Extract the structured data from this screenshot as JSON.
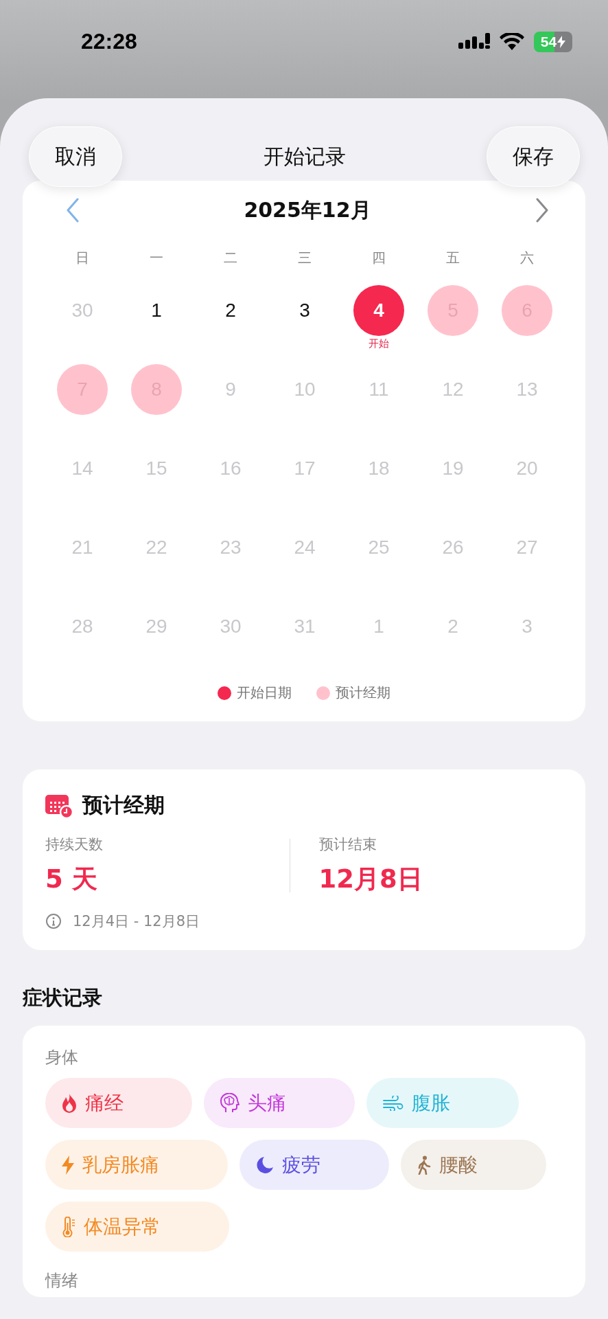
{
  "status_bar": {
    "time": "22:28",
    "battery": "54"
  },
  "header": {
    "cancel": "取消",
    "title": "开始记录",
    "save": "保存"
  },
  "calendar": {
    "month": "2025年12月",
    "weekdays": [
      "日",
      "一",
      "二",
      "三",
      "四",
      "五",
      "六"
    ],
    "days": [
      {
        "day": "30",
        "kind": "dim"
      },
      {
        "day": "1",
        "kind": "plain"
      },
      {
        "day": "2",
        "kind": "plain"
      },
      {
        "day": "3",
        "kind": "plain"
      },
      {
        "day": "4",
        "kind": "start",
        "label": "开始"
      },
      {
        "day": "5",
        "kind": "predicted"
      },
      {
        "day": "6",
        "kind": "predicted"
      },
      {
        "day": "7",
        "kind": "predicted"
      },
      {
        "day": "8",
        "kind": "predicted"
      },
      {
        "day": "9",
        "kind": "dim"
      },
      {
        "day": "10",
        "kind": "dim"
      },
      {
        "day": "11",
        "kind": "dim"
      },
      {
        "day": "12",
        "kind": "dim"
      },
      {
        "day": "13",
        "kind": "dim"
      },
      {
        "day": "14",
        "kind": "dim"
      },
      {
        "day": "15",
        "kind": "dim"
      },
      {
        "day": "16",
        "kind": "dim"
      },
      {
        "day": "17",
        "kind": "dim"
      },
      {
        "day": "18",
        "kind": "dim"
      },
      {
        "day": "19",
        "kind": "dim"
      },
      {
        "day": "20",
        "kind": "dim"
      },
      {
        "day": "21",
        "kind": "dim"
      },
      {
        "day": "22",
        "kind": "dim"
      },
      {
        "day": "23",
        "kind": "dim"
      },
      {
        "day": "24",
        "kind": "dim"
      },
      {
        "day": "25",
        "kind": "dim"
      },
      {
        "day": "26",
        "kind": "dim"
      },
      {
        "day": "27",
        "kind": "dim"
      },
      {
        "day": "28",
        "kind": "dim"
      },
      {
        "day": "29",
        "kind": "dim"
      },
      {
        "day": "30",
        "kind": "dim"
      },
      {
        "day": "31",
        "kind": "dim"
      },
      {
        "day": "1",
        "kind": "dim"
      },
      {
        "day": "2",
        "kind": "dim"
      },
      {
        "day": "3",
        "kind": "dim"
      }
    ],
    "legend": [
      {
        "label": "开始日期",
        "color": "#f5284f"
      },
      {
        "label": "预计经期",
        "color": "#ffc2cc"
      }
    ]
  },
  "prediction": {
    "title": "预计经期",
    "duration_label": "持续天数",
    "duration": "5 天",
    "end_label": "预计结束",
    "end": "12月8日",
    "range": "12月4日 - 12月8日"
  },
  "symptoms": {
    "heading": "症状记录",
    "groups": [
      {
        "title": "身体",
        "chips": [
          {
            "label": "痛经",
            "kind": "flame",
            "color": "#ef3348"
          },
          {
            "label": "头痛",
            "kind": "brain",
            "color": "#c236d8"
          },
          {
            "label": "腹胀",
            "kind": "wind",
            "color": "#1fb3d4"
          },
          {
            "label": "乳房胀痛",
            "kind": "bolt",
            "color": "#f28a22"
          },
          {
            "label": "疲劳",
            "kind": "moon",
            "color": "#5b4fe2"
          },
          {
            "label": "腰酸",
            "kind": "walk",
            "color": "#9b7552"
          },
          {
            "label": "体温异常",
            "kind": "thermometer",
            "color": "#f28a22"
          }
        ]
      },
      {
        "title": "情绪"
      }
    ]
  }
}
